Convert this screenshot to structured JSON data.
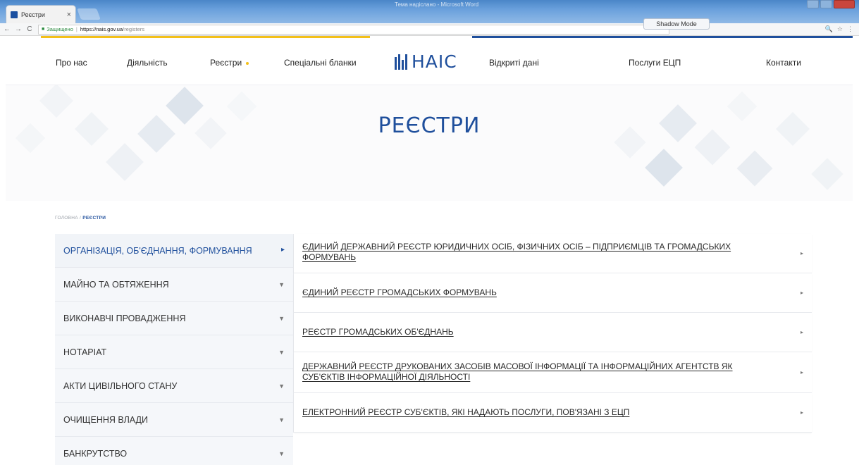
{
  "browser": {
    "tab_title": "Реєстри",
    "tab_close": "×",
    "window_title": "Тема надіслано - Microsoft Word",
    "secure_label": "Защищено",
    "url_host": "https://nais.gov.ua",
    "url_path": "/registers",
    "shadow_mode": "Shadow Mode",
    "back": "←",
    "forward": "→",
    "reload": "C",
    "zoom": "🔍",
    "star": "☆",
    "menu": "⋮"
  },
  "nav": {
    "items": [
      "Про нас",
      "Діяльність",
      "Реєстри",
      "Спеціальні бланки",
      "Відкриті дані",
      "Послуги ЕЦП",
      "Контакти"
    ],
    "logo_text": "НАІС"
  },
  "hero": {
    "title": "РЕЄСТРИ"
  },
  "breadcrumb": {
    "home": "ГОЛОВНА",
    "separator": " / ",
    "current": "РЕЄСТРИ"
  },
  "menu": {
    "items": [
      "ОРГАНІЗАЦІЯ, ОБ'ЄДНАННЯ, ФОРМУВАННЯ",
      "МАЙНО ТА ОБТЯЖЕННЯ",
      "ВИКОНАВЧІ ПРОВАДЖЕННЯ",
      "НОТАРІАТ",
      "АКТИ ЦИВІЛЬНОГО СТАНУ",
      "ОЧИЩЕННЯ ВЛАДИ",
      "БАНКРУТСТВО"
    ],
    "active_caret": "▸",
    "caret": "▼"
  },
  "registers": {
    "items": [
      "ЄДИНИЙ ДЕРЖАВНИЙ РЕЄСТР ЮРИДИЧНИХ ОСІБ, ФІЗИЧНИХ ОСІБ – ПІДПРИЄМЦІВ ТА ГРОМАДСЬКИХ ФОРМУВАНЬ",
      "ЄДИНИЙ РЕЄСТР ГРОМАДСЬКИХ ФОРМУВАНЬ",
      "РЕЄСТР ГРОМАДСЬКИХ ОБ'ЄДНАНЬ",
      "ДЕРЖАВНИЙ РЕЄСТР ДРУКОВАНИХ ЗАСОБІВ МАСОВОЇ ІНФОРМАЦІЇ ТА ІНФОРМАЦІЙНИХ АГЕНТСТВ ЯК СУБ'ЄКТІВ ІНФОРМАЦІЙНОЇ ДІЯЛЬНОСТІ",
      "ЕЛЕКТРОННИЙ РЕЄСТР СУБ'ЄКТІВ, ЯКІ НАДАЮТЬ ПОСЛУГИ, ПОВ'ЯЗАНІ З ЕЦП"
    ],
    "arrow": "▸"
  },
  "colors": {
    "brand_blue": "#1f4f9c",
    "accent_yellow": "#f3c019"
  }
}
